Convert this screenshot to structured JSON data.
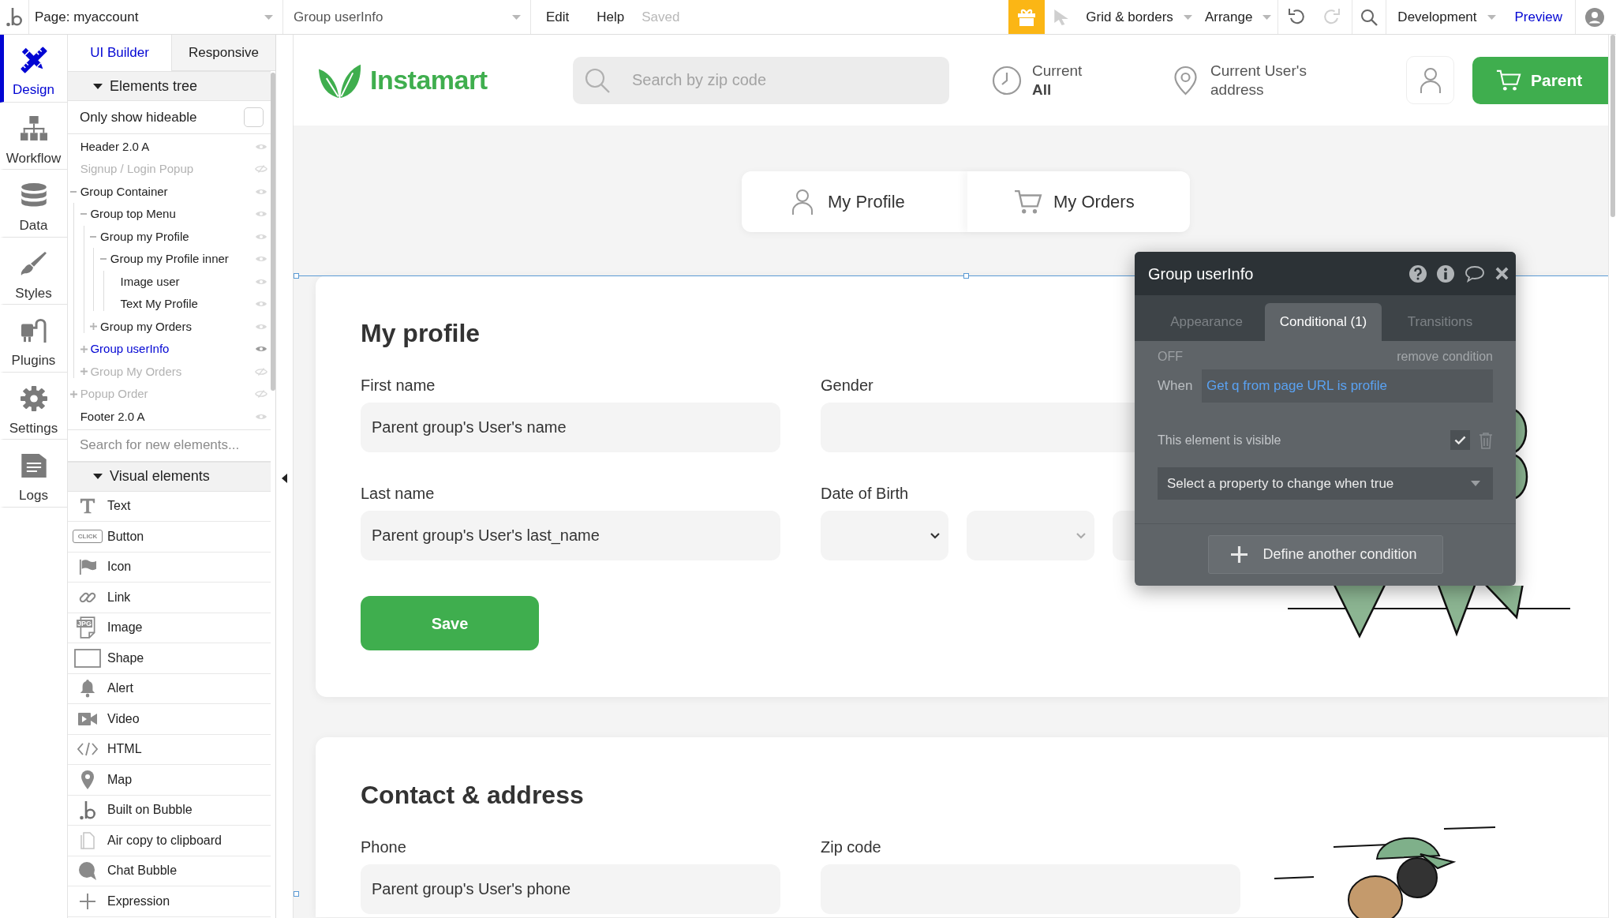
{
  "top_bar": {
    "page_selector": "Page: myaccount",
    "element_selector": "Group userInfo",
    "menu": [
      "Edit",
      "Help"
    ],
    "save_status": "Saved",
    "tool_groups": [
      [
        {
          "kind": "gift"
        },
        {
          "kind": "pointer",
          "disabled": true
        },
        {
          "kind": "dropdown",
          "label": "Grid & borders"
        },
        {
          "kind": "dropdown",
          "label": "Arrange"
        }
      ],
      [
        {
          "kind": "undo",
          "disabled": false
        },
        {
          "kind": "redo",
          "disabled": true
        }
      ],
      [
        {
          "kind": "search"
        }
      ],
      [
        {
          "kind": "dropdown",
          "label": "Development"
        },
        {
          "kind": "link",
          "label": "Preview"
        }
      ],
      [
        {
          "kind": "avatar"
        }
      ]
    ]
  },
  "sidebar": {
    "items": [
      {
        "kind": "design",
        "label": "Design",
        "selected": true
      },
      {
        "kind": "workflow",
        "label": "Workflow",
        "selected": false
      },
      {
        "kind": "data",
        "label": "Data",
        "selected": false
      },
      {
        "kind": "styles",
        "label": "Styles",
        "selected": false
      },
      {
        "kind": "plugins",
        "label": "Plugins",
        "selected": false
      },
      {
        "kind": "settings",
        "label": "Settings",
        "selected": false
      },
      {
        "kind": "logs",
        "label": "Logs",
        "selected": false
      }
    ]
  },
  "panel": {
    "tabs": [
      {
        "label": "UI Builder",
        "selected": true
      },
      {
        "label": "Responsive",
        "selected": false
      }
    ],
    "elements_tree": {
      "title": "Elements tree",
      "expanded": true,
      "filter": {
        "label": "Only show hideable",
        "checked": false
      },
      "items": [
        {
          "label": "Header 2.0 A",
          "visible": true,
          "selected": false
        },
        {
          "label": "Signup / Login Popup",
          "visible": false,
          "selected": false
        },
        {
          "label": "Group Container",
          "visible": true,
          "selected": false,
          "expanded": true,
          "children": [
            {
              "label": "Group top Menu",
              "visible": true,
              "selected": false,
              "expanded": true,
              "children": [
                {
                  "label": "Group my Profile",
                  "visible": true,
                  "selected": false,
                  "expanded": true,
                  "children": [
                    {
                      "label": "Group my Profile inner",
                      "visible": true,
                      "selected": false,
                      "expanded": true,
                      "children": [
                        {
                          "label": "Image user",
                          "visible": true,
                          "selected": false
                        },
                        {
                          "label": "Text My Profile",
                          "visible": true,
                          "selected": false
                        }
                      ]
                    }
                  ]
                },
                {
                  "label": "Group my Orders",
                  "visible": true,
                  "selected": false,
                  "expanded": false
                }
              ]
            },
            {
              "label": "Group userInfo",
              "visible": true,
              "selected": true,
              "expanded": false
            },
            {
              "label": "Group My Orders",
              "visible": false,
              "selected": false,
              "expanded": false
            }
          ]
        },
        {
          "label": "Popup Order",
          "visible": false,
          "selected": false,
          "expanded": false
        },
        {
          "label": "Footer 2.0 A",
          "visible": true,
          "selected": false
        }
      ]
    },
    "search": {
      "placeholder": "Search for new elements..."
    },
    "visual_elements": {
      "title": "Visual elements",
      "expanded": true,
      "items": [
        {
          "kind": "text",
          "label": "Text"
        },
        {
          "kind": "button",
          "label": "Button",
          "icon_text": "CLICK"
        },
        {
          "kind": "icon",
          "label": "Icon"
        },
        {
          "kind": "link",
          "label": "Link"
        },
        {
          "kind": "image",
          "label": "Image",
          "icon_text": "JPG"
        },
        {
          "kind": "shape",
          "label": "Shape"
        },
        {
          "kind": "alert",
          "label": "Alert"
        },
        {
          "kind": "video",
          "label": "Video"
        },
        {
          "kind": "html",
          "label": "HTML"
        },
        {
          "kind": "map",
          "label": "Map"
        },
        {
          "kind": "bubble",
          "label": "Built on Bubble"
        },
        {
          "kind": "clipboard",
          "label": "Air copy to clipboard"
        },
        {
          "kind": "chat",
          "label": "Chat Bubble"
        },
        {
          "kind": "expression",
          "label": "Expression"
        }
      ]
    }
  },
  "canvas": {
    "header": {
      "logo": "Instamart",
      "search": {
        "placeholder": "Search by zip code"
      },
      "time": {
        "label": "Current",
        "value": "All"
      },
      "location": {
        "text": "Current User's address"
      },
      "cart_button": {
        "label": "Parent"
      }
    },
    "tabs": [
      {
        "kind": "profile",
        "label": "My Profile"
      },
      {
        "kind": "orders",
        "label": "My Orders"
      }
    ],
    "profile": {
      "title": "My profile",
      "fields": [
        {
          "kind": "text",
          "label": "First name",
          "value": "Parent group's User's name"
        },
        {
          "kind": "text",
          "label": "Gender"
        },
        {
          "kind": "text",
          "label": "Last name",
          "value": "Parent group's User's last_name"
        },
        {
          "kind": "date",
          "label": "Date of Birth"
        }
      ],
      "save_button": "Save"
    },
    "contact": {
      "title": "Contact & address",
      "fields": [
        {
          "kind": "text",
          "label": "Phone",
          "value": "Parent group's User's phone"
        },
        {
          "kind": "text",
          "label": "Zip code"
        }
      ]
    }
  },
  "property_editor": {
    "title": "Group userInfo",
    "tabs": [
      {
        "label": "Appearance",
        "selected": false
      },
      {
        "label": "Conditional (1)",
        "selected": true
      },
      {
        "label": "Transitions",
        "selected": false
      }
    ],
    "condition": {
      "status": "OFF",
      "remove_link": "remove condition",
      "when_label": "When",
      "expression": "Get q from page URL is profile",
      "property": {
        "label": "This element is visible",
        "checked": true
      },
      "property_select": {
        "placeholder": "Select a property to change when true"
      }
    },
    "add_button": "Define another condition"
  }
}
